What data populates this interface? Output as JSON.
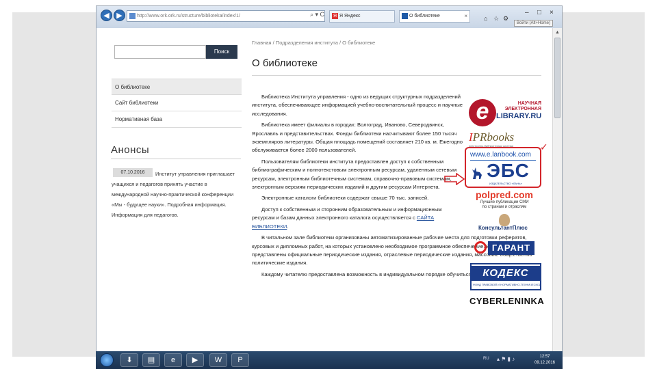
{
  "browser": {
    "address_url": "http://www.ork.ork.ru/structure/biblioteka/index/1/",
    "address_tools": "⌕ ▾ C",
    "tabs": [
      {
        "label": "Я Яндекс",
        "icon": "yandex-icon"
      },
      {
        "label": "О библиотеке",
        "icon": "site-favicon"
      }
    ],
    "window_controls": [
      "–",
      "□",
      "×"
    ],
    "toolbar_icons": [
      "home-icon",
      "star-icon",
      "gear-icon"
    ],
    "login_label": "Войти (Alt+Home)"
  },
  "search": {
    "placeholder": "",
    "button_label": "Поиск"
  },
  "sidebar": {
    "items": [
      {
        "label": "О библиотеке",
        "active": true
      },
      {
        "label": "Сайт библиотеки",
        "active": false
      },
      {
        "label": "Нормативная база",
        "active": false
      }
    ]
  },
  "anons": {
    "title": "Анонсы",
    "date": "07.10.2016",
    "text": "Институт управления приглашает учащихся и педагогов принять участие в международной научно-практической конференции «Мы - будущее науки». Подробная информация. Информация для педагогов."
  },
  "breadcrumb": "Главная / Подразделения института / О библиотеке",
  "page_title": "О библиотеке",
  "article": {
    "paragraphs": [
      "Библиотека Института управления - одно из ведущих структурных подразделений института, обеспечивающее информацией учебно-воспитательный процесс и научные исследования.",
      "Библиотека имеет филиалы в городах: Волгоград, Иваново, Северодвинск, Ярославль и представительствах. Фонды библиотеки насчитывают более 150 тысяч экземпляров литературы. Общая площадь помещений составляет 210 кв. м. Ежегодно обслуживается более 2000 пользователей.",
      "Пользователям библиотеки института предоставлен доступ к собственным библиографическим и полнотекстовым электронным ресурсам, удаленным сетевым ресурсам, электронным библиотечным системам, справочно-правовым системам, электронным версиям периодических изданий и другим ресурсам Интернета.",
      "Электронные каталоги библиотеки содержат свыше 70 тыс. записей."
    ],
    "access_text": "Доступ к собственным и сторонним образовательным и информационным ресурсам и базам данных электронного каталога осуществляется с",
    "access_link": "САЙТА БИБЛИОТЕКИ",
    "paragraphs_after": [
      "В читальном зале библиотеки организованы автоматизированные рабочие места для подготовки рефератов, курсовых и дипломных работ, на которых установлено необходимое программное обеспечение. В открытом доступе представлены официальные периодические издания, отраслевые периодические издания, массовые общественно-политические издания.",
      "Каждому читателю предоставлена возможность в индивидуальном порядке обучиться работе"
    ]
  },
  "logos": {
    "elibrary": {
      "letter": "e",
      "line1": "НАУЧНАЯ",
      "line2": "ЭЛЕКТРОННАЯ",
      "line3": "LIBRARY.RU"
    },
    "iprbooks": {
      "main_prefix": "I",
      "main_rest": "PRbooks",
      "sub": "электронно-библиотечная система"
    },
    "lanbook": {
      "url": "www.e.lanbook.com",
      "ebs": "ЭБС",
      "sub": "ИЗДАТЕЛЬСТВО «ЛАНЬ»"
    },
    "polpred": {
      "main": "polpred.com",
      "sub1": "Лучшие публикации СМИ",
      "sub2": "по странам и отраслям"
    },
    "konsultant": {
      "label": "КонсультантПлюс"
    },
    "garant": {
      "label": "ГАРАНТ"
    },
    "kodeks": {
      "label": "КОДЕКС",
      "sub": "ФОНД ПРАВОВОЙ И НОРМАТИВНО-ТЕХНИЧЕСКОЙ"
    },
    "cyberleninka": {
      "label": "CYBERLENINKA"
    }
  },
  "taskbar": {
    "apps": [
      "download-icon",
      "folder-icon",
      "ie-icon",
      "media-icon",
      "word-icon",
      "ppt-icon"
    ],
    "lang": "RU",
    "time": "12:57",
    "date": "09.12.2016"
  },
  "colors": {
    "accent_nav": "#2b3a4e",
    "highlight_red": "#d3252a",
    "link_blue": "#1f4e99"
  }
}
